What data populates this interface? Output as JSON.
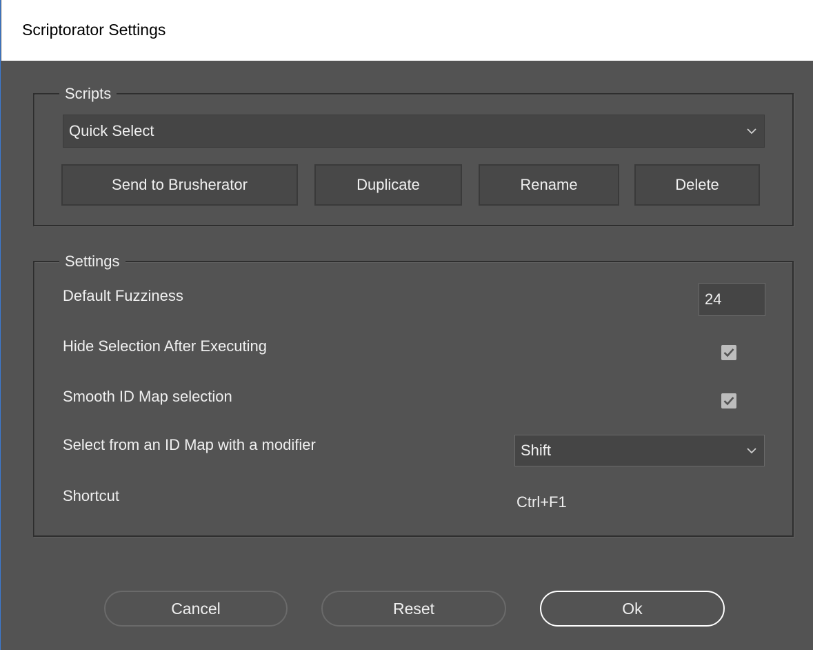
{
  "window": {
    "title": "Scriptorator Settings"
  },
  "scripts_group": {
    "label": "Scripts",
    "selected_script": "Quick Select",
    "buttons": {
      "send": "Send to Brusherator",
      "duplicate": "Duplicate",
      "rename": "Rename",
      "delete": "Delete"
    }
  },
  "settings_group": {
    "label": "Settings",
    "fuzziness": {
      "label": "Default Fuzziness",
      "value": "24"
    },
    "hide_selection": {
      "label": "Hide Selection After Executing",
      "checked": true
    },
    "smooth_id_map": {
      "label": "Smooth ID Map selection",
      "checked": true
    },
    "modifier": {
      "label": "Select from an ID Map with a modifier",
      "value": "Shift"
    },
    "shortcut": {
      "label": "Shortcut",
      "value": "Ctrl+F1"
    }
  },
  "footer": {
    "cancel": "Cancel",
    "reset": "Reset",
    "ok": "Ok"
  },
  "icons": {
    "dropdown": "chevron-down-icon",
    "check": "checkmark-icon"
  },
  "colors": {
    "background": "#535353",
    "titlebar": "#ffffff",
    "text": "#f0f0f0",
    "control": "#454545"
  }
}
